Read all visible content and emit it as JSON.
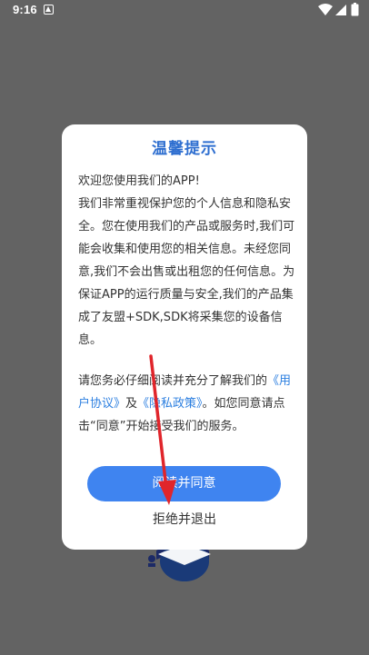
{
  "status_bar": {
    "time": "9:16"
  },
  "dialog": {
    "title": "温馨提示",
    "greeting": "欢迎您使用我们的APP!",
    "paragraph_1": "我们非常重视保护您的个人信息和隐私安全。您在使用我们的产品或服务时,我们可能会收集和使用您的相关信息。未经您同意,我们不会出售或出租您的任何信息。为保证APP的运行质量与安全,我们的产品集成了友盟+SDK,SDK将采集您的设备信息。",
    "paragraph_2_intro": "请您务必仔细阅读并充分了解我们的",
    "user_agreement_link": "《用户协议》",
    "and_text": "及",
    "privacy_policy_link": "《隐私政策》",
    "paragraph_2_outro": "。如您同意请点击“同意”开始接受我们的服务。",
    "agree_label": "阅读并同意",
    "reject_label": "拒绝并退出"
  },
  "colors": {
    "backdrop": "#636363",
    "title": "#2f6fd0",
    "link": "#2c7fe0",
    "button": "#3f84f0",
    "annotation_arrow": "#e0252b"
  }
}
